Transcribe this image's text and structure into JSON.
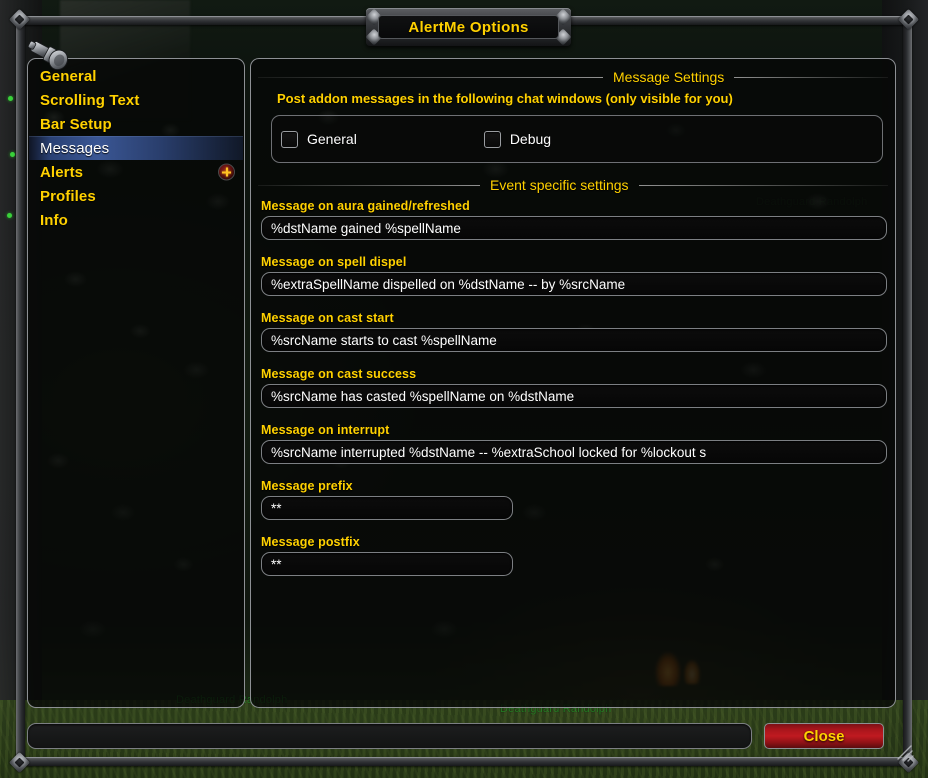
{
  "window": {
    "title": "AlertMe Options"
  },
  "sidebar": {
    "items": [
      {
        "label": "General",
        "selected": false,
        "expandable": false
      },
      {
        "label": "Scrolling Text",
        "selected": false,
        "expandable": false
      },
      {
        "label": "Bar Setup",
        "selected": false,
        "expandable": false
      },
      {
        "label": "Messages",
        "selected": true,
        "expandable": false
      },
      {
        "label": "Alerts",
        "selected": false,
        "expandable": true
      },
      {
        "label": "Profiles",
        "selected": false,
        "expandable": false
      },
      {
        "label": "Info",
        "selected": false,
        "expandable": false
      }
    ]
  },
  "content": {
    "section1_title": "Message Settings",
    "section1_description": "Post addon messages in the following chat windows (only visible for you)",
    "checkboxes": [
      {
        "label": "General",
        "checked": false
      },
      {
        "label": "Debug",
        "checked": false
      }
    ],
    "section2_title": "Event specific settings",
    "fields": [
      {
        "label": "Message on aura gained/refreshed",
        "value": "%dstName gained %spellName",
        "placeholder": ""
      },
      {
        "label": "Message on spell dispel",
        "value": "%extraSpellName dispelled on %dstName -- by %srcName",
        "placeholder": ""
      },
      {
        "label": "Message on cast start",
        "value": "%srcName starts to cast %spellName",
        "placeholder": ""
      },
      {
        "label": "Message on cast success",
        "value": "%srcName has casted %spellName on %dstName",
        "placeholder": ""
      },
      {
        "label": "Message on interrupt",
        "value": "%srcName interrupted %dstName -- %extraSchool locked for %lockout s",
        "placeholder": ""
      },
      {
        "label": "Message prefix",
        "value": "**",
        "placeholder": ""
      },
      {
        "label": "Message postfix",
        "value": "**",
        "placeholder": ""
      }
    ]
  },
  "footer": {
    "status_value": "",
    "status_placeholder": "",
    "close_label": "Close"
  },
  "world": {
    "nameplates": [
      {
        "text": "Deathguard Randolph"
      },
      {
        "text": "Deathguard Randolph"
      },
      {
        "text": "Deathguard Randolph"
      }
    ]
  },
  "colors": {
    "gold": "#ffd100",
    "selected_blue": "#3a5694",
    "close_red": "#c01a20",
    "panel_border": "#8d9094",
    "text_white": "#ffffff",
    "nameplate_green": "#1f9c28"
  }
}
